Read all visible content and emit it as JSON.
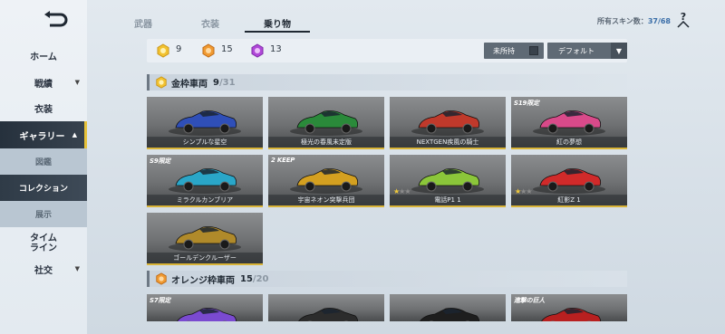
{
  "sidebar": {
    "home": "ホーム",
    "career": "戦績",
    "outfit": "衣装",
    "gallery": "ギャラリー",
    "sub_illustrated": "図鑑",
    "sub_collection": "コレクション",
    "sub_display": "展示",
    "timeline": "タイム\nライン",
    "social": "社交"
  },
  "tabs": [
    "武器",
    "衣装",
    "乗り物"
  ],
  "active_tab": "乗り物",
  "skin_count": {
    "label": "所有スキン数：",
    "value": "37/68"
  },
  "filter": {
    "gold_count": "9",
    "orange_count": "15",
    "purple_count": "13",
    "unowned_label": "未所持",
    "sort_label": "デフォルト"
  },
  "sections": [
    {
      "title": "金枠車両",
      "owned": "9",
      "total": "/31",
      "cards": [
        {
          "label": "シンプルな星空",
          "badge": "",
          "stars": 0,
          "car_color": "#2f4fb8"
        },
        {
          "label": "極光の春風未定版",
          "badge": "",
          "stars": 0,
          "car_color": "#2a8a3a"
        },
        {
          "label": "NEXTGEN疾風の騎士",
          "badge": "",
          "stars": 0,
          "car_color": "#c0392b"
        },
        {
          "label": "紅の夢想",
          "badge": "S19限定",
          "stars": 0,
          "car_color": "#d94a8a"
        },
        {
          "label": "ミラクルカンブリア",
          "badge": "S9限定",
          "stars": 0,
          "car_color": "#2aa6c8"
        },
        {
          "label": "宇宙ネオン突撃兵団",
          "badge": "2 KEEP",
          "stars": 0,
          "car_color": "#d4a020"
        },
        {
          "label": "電話P1 1",
          "badge": "",
          "stars": 1,
          "car_color": "#8bc63a"
        },
        {
          "label": "紅影Z 1",
          "badge": "",
          "stars": 1,
          "car_color": "#d12a2a"
        },
        {
          "label": "ゴールデンクルーザー",
          "badge": "",
          "stars": 0,
          "car_color": "#b08a2a"
        }
      ]
    },
    {
      "title": "オレンジ枠車両",
      "owned": "15",
      "total": "/20",
      "cards": [
        {
          "label": "",
          "badge": "S7限定",
          "stars": 0,
          "car_color": "#7a4ad0"
        },
        {
          "label": "",
          "badge": "",
          "stars": 0,
          "car_color": "#2c2c2c"
        },
        {
          "label": "",
          "badge": "",
          "stars": 0,
          "car_color": "#1e1e1e"
        },
        {
          "label": "",
          "badge": "進撃の巨人",
          "stars": 0,
          "car_color": "#b82020"
        }
      ]
    }
  ]
}
